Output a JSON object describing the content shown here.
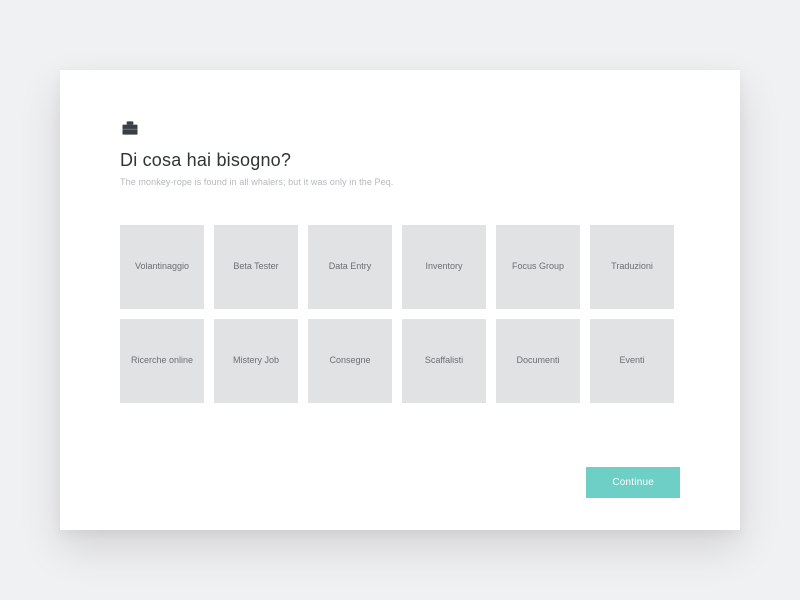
{
  "header": {
    "title": "Di cosa hai bisogno?",
    "subtitle": "The monkey-rope is found in all whalers; but it was only in the Peq."
  },
  "tiles": [
    {
      "label": "Volantinaggio"
    },
    {
      "label": "Beta Tester"
    },
    {
      "label": "Data Entry"
    },
    {
      "label": "Inventory"
    },
    {
      "label": "Focus Group"
    },
    {
      "label": "Traduzioni"
    },
    {
      "label": "Ricerche online"
    },
    {
      "label": "Mistery Job"
    },
    {
      "label": "Consegne"
    },
    {
      "label": "Scaffalisti"
    },
    {
      "label": "Documenti"
    },
    {
      "label": "Eventi"
    }
  ],
  "actions": {
    "continue_label": "Continue"
  },
  "colors": {
    "accent": "#6ecfc6",
    "tile_bg": "#e1e2e4"
  }
}
